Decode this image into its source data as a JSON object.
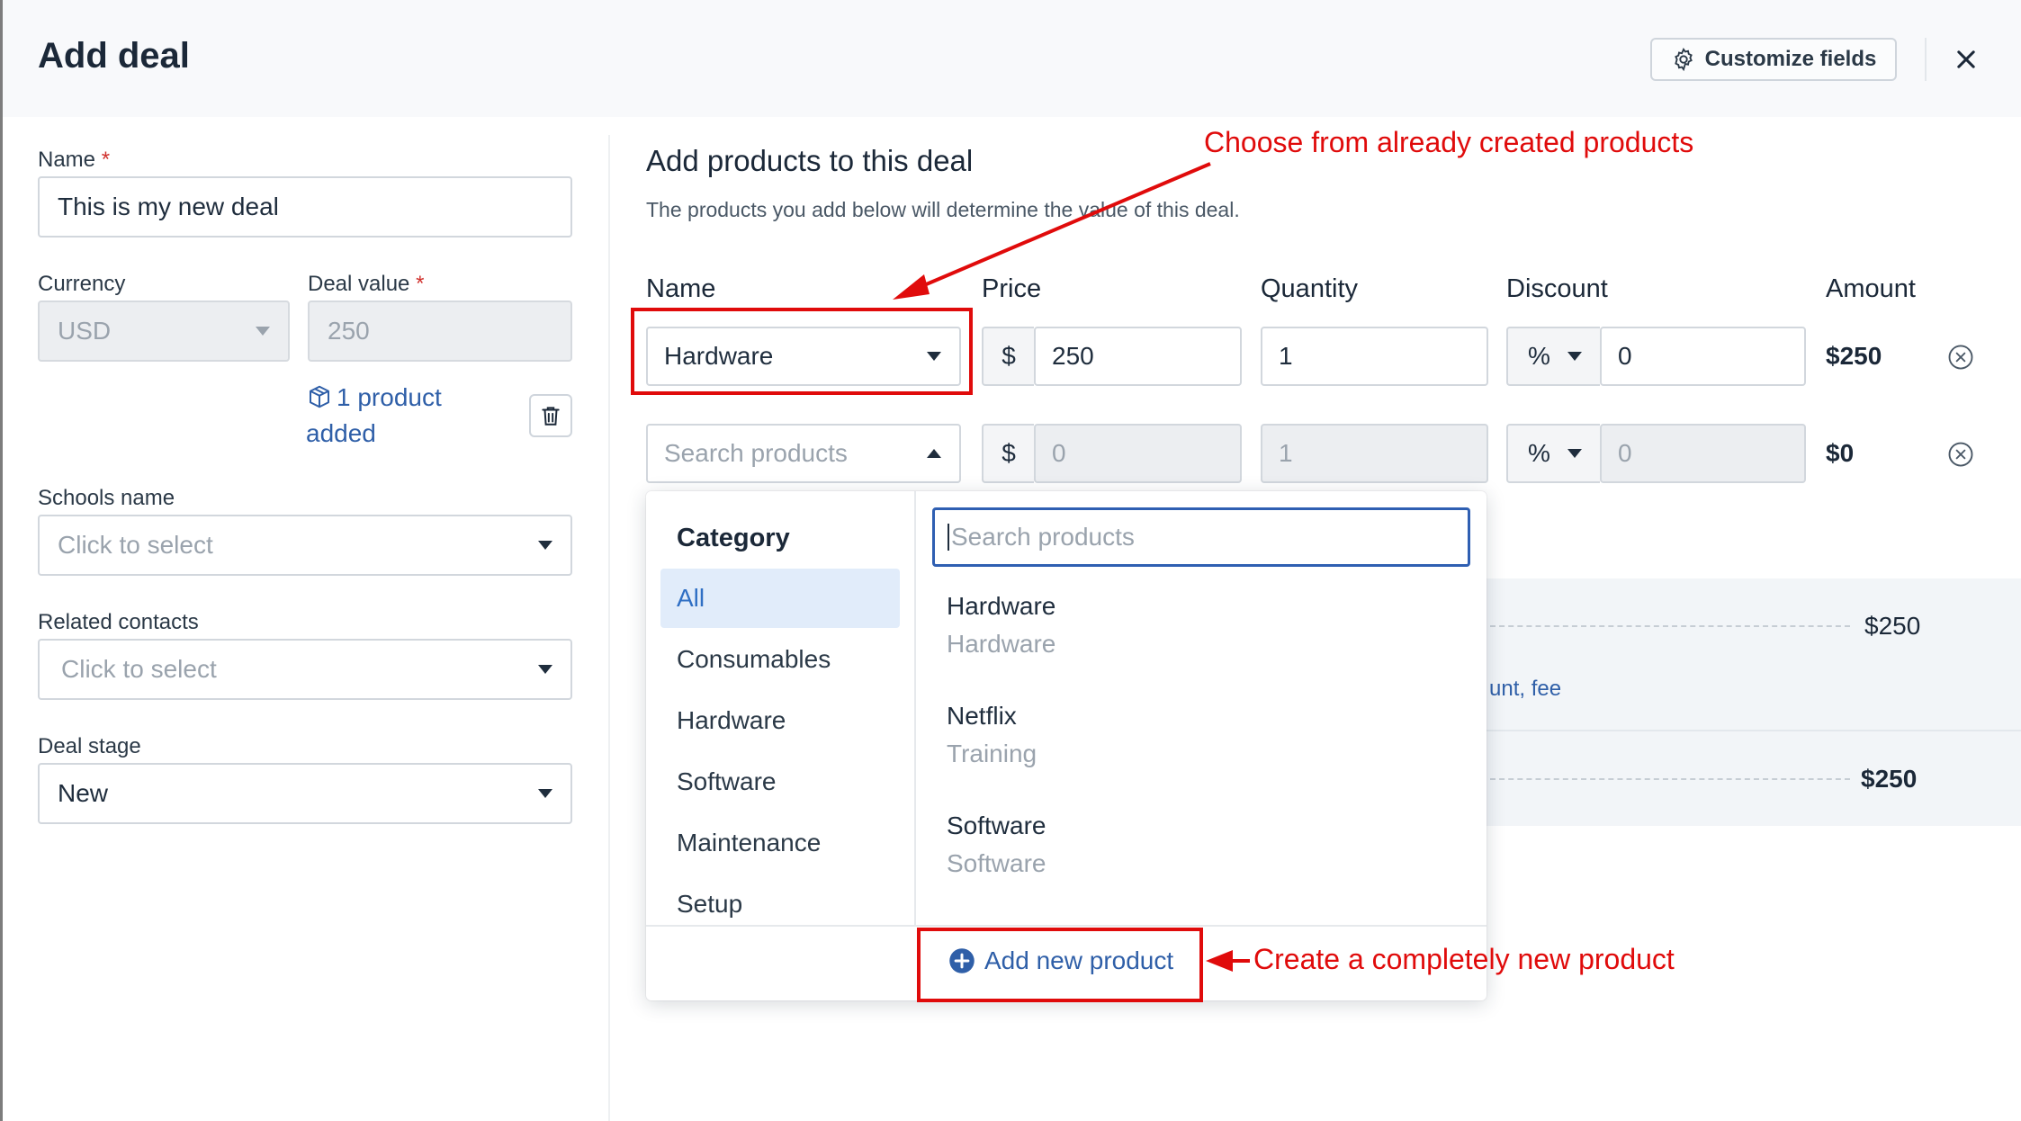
{
  "header": {
    "title": "Add deal",
    "customize_label": "Customize fields"
  },
  "form": {
    "name_label": "Name",
    "name_value": "This is my new deal",
    "currency_label": "Currency",
    "currency_value": "USD",
    "deal_value_label": "Deal value",
    "deal_value": "250",
    "product_link": "1 product added",
    "schools_label": "Schools name",
    "schools_placeholder": "Click to select",
    "contacts_label": "Related contacts",
    "contacts_placeholder": "Click to select",
    "stage_label": "Deal stage",
    "stage_value": "New",
    "required_mark": "*"
  },
  "products": {
    "title": "Add products to this deal",
    "description": "The products you add below will determine the value of this deal.",
    "columns": [
      "Name",
      "Price",
      "Quantity",
      "Discount",
      "Amount"
    ],
    "rows": [
      {
        "name": "Hardware",
        "currency": "$",
        "price": "250",
        "quantity": "1",
        "discount_type": "%",
        "discount": "0",
        "amount": "$250"
      },
      {
        "name_placeholder": "Search products",
        "currency": "$",
        "price": "0",
        "quantity": "1",
        "discount_type": "%",
        "discount": "0",
        "amount": "$0"
      }
    ]
  },
  "dropdown": {
    "category_heading": "Category",
    "categories": [
      "All",
      "Consumables",
      "Hardware",
      "Software",
      "Maintenance",
      "Setup"
    ],
    "active_category": "All",
    "search_placeholder": "Search products",
    "items": [
      {
        "name": "Hardware",
        "category": "Hardware"
      },
      {
        "name": "Netflix",
        "category": "Training"
      },
      {
        "name": "Software",
        "category": "Software"
      }
    ],
    "add_new_label": "Add new product"
  },
  "summary": {
    "subtotal": "$250",
    "link_fragment": "unt, fee",
    "total": "$250"
  },
  "annotations": {
    "top": "Choose from already created products",
    "bottom": "Create a completely new product",
    "color": "#e00b0b"
  },
  "colors": {
    "accent": "#2f5fa8",
    "active_bg": "#e1ecfa",
    "required": "#d0312d"
  }
}
